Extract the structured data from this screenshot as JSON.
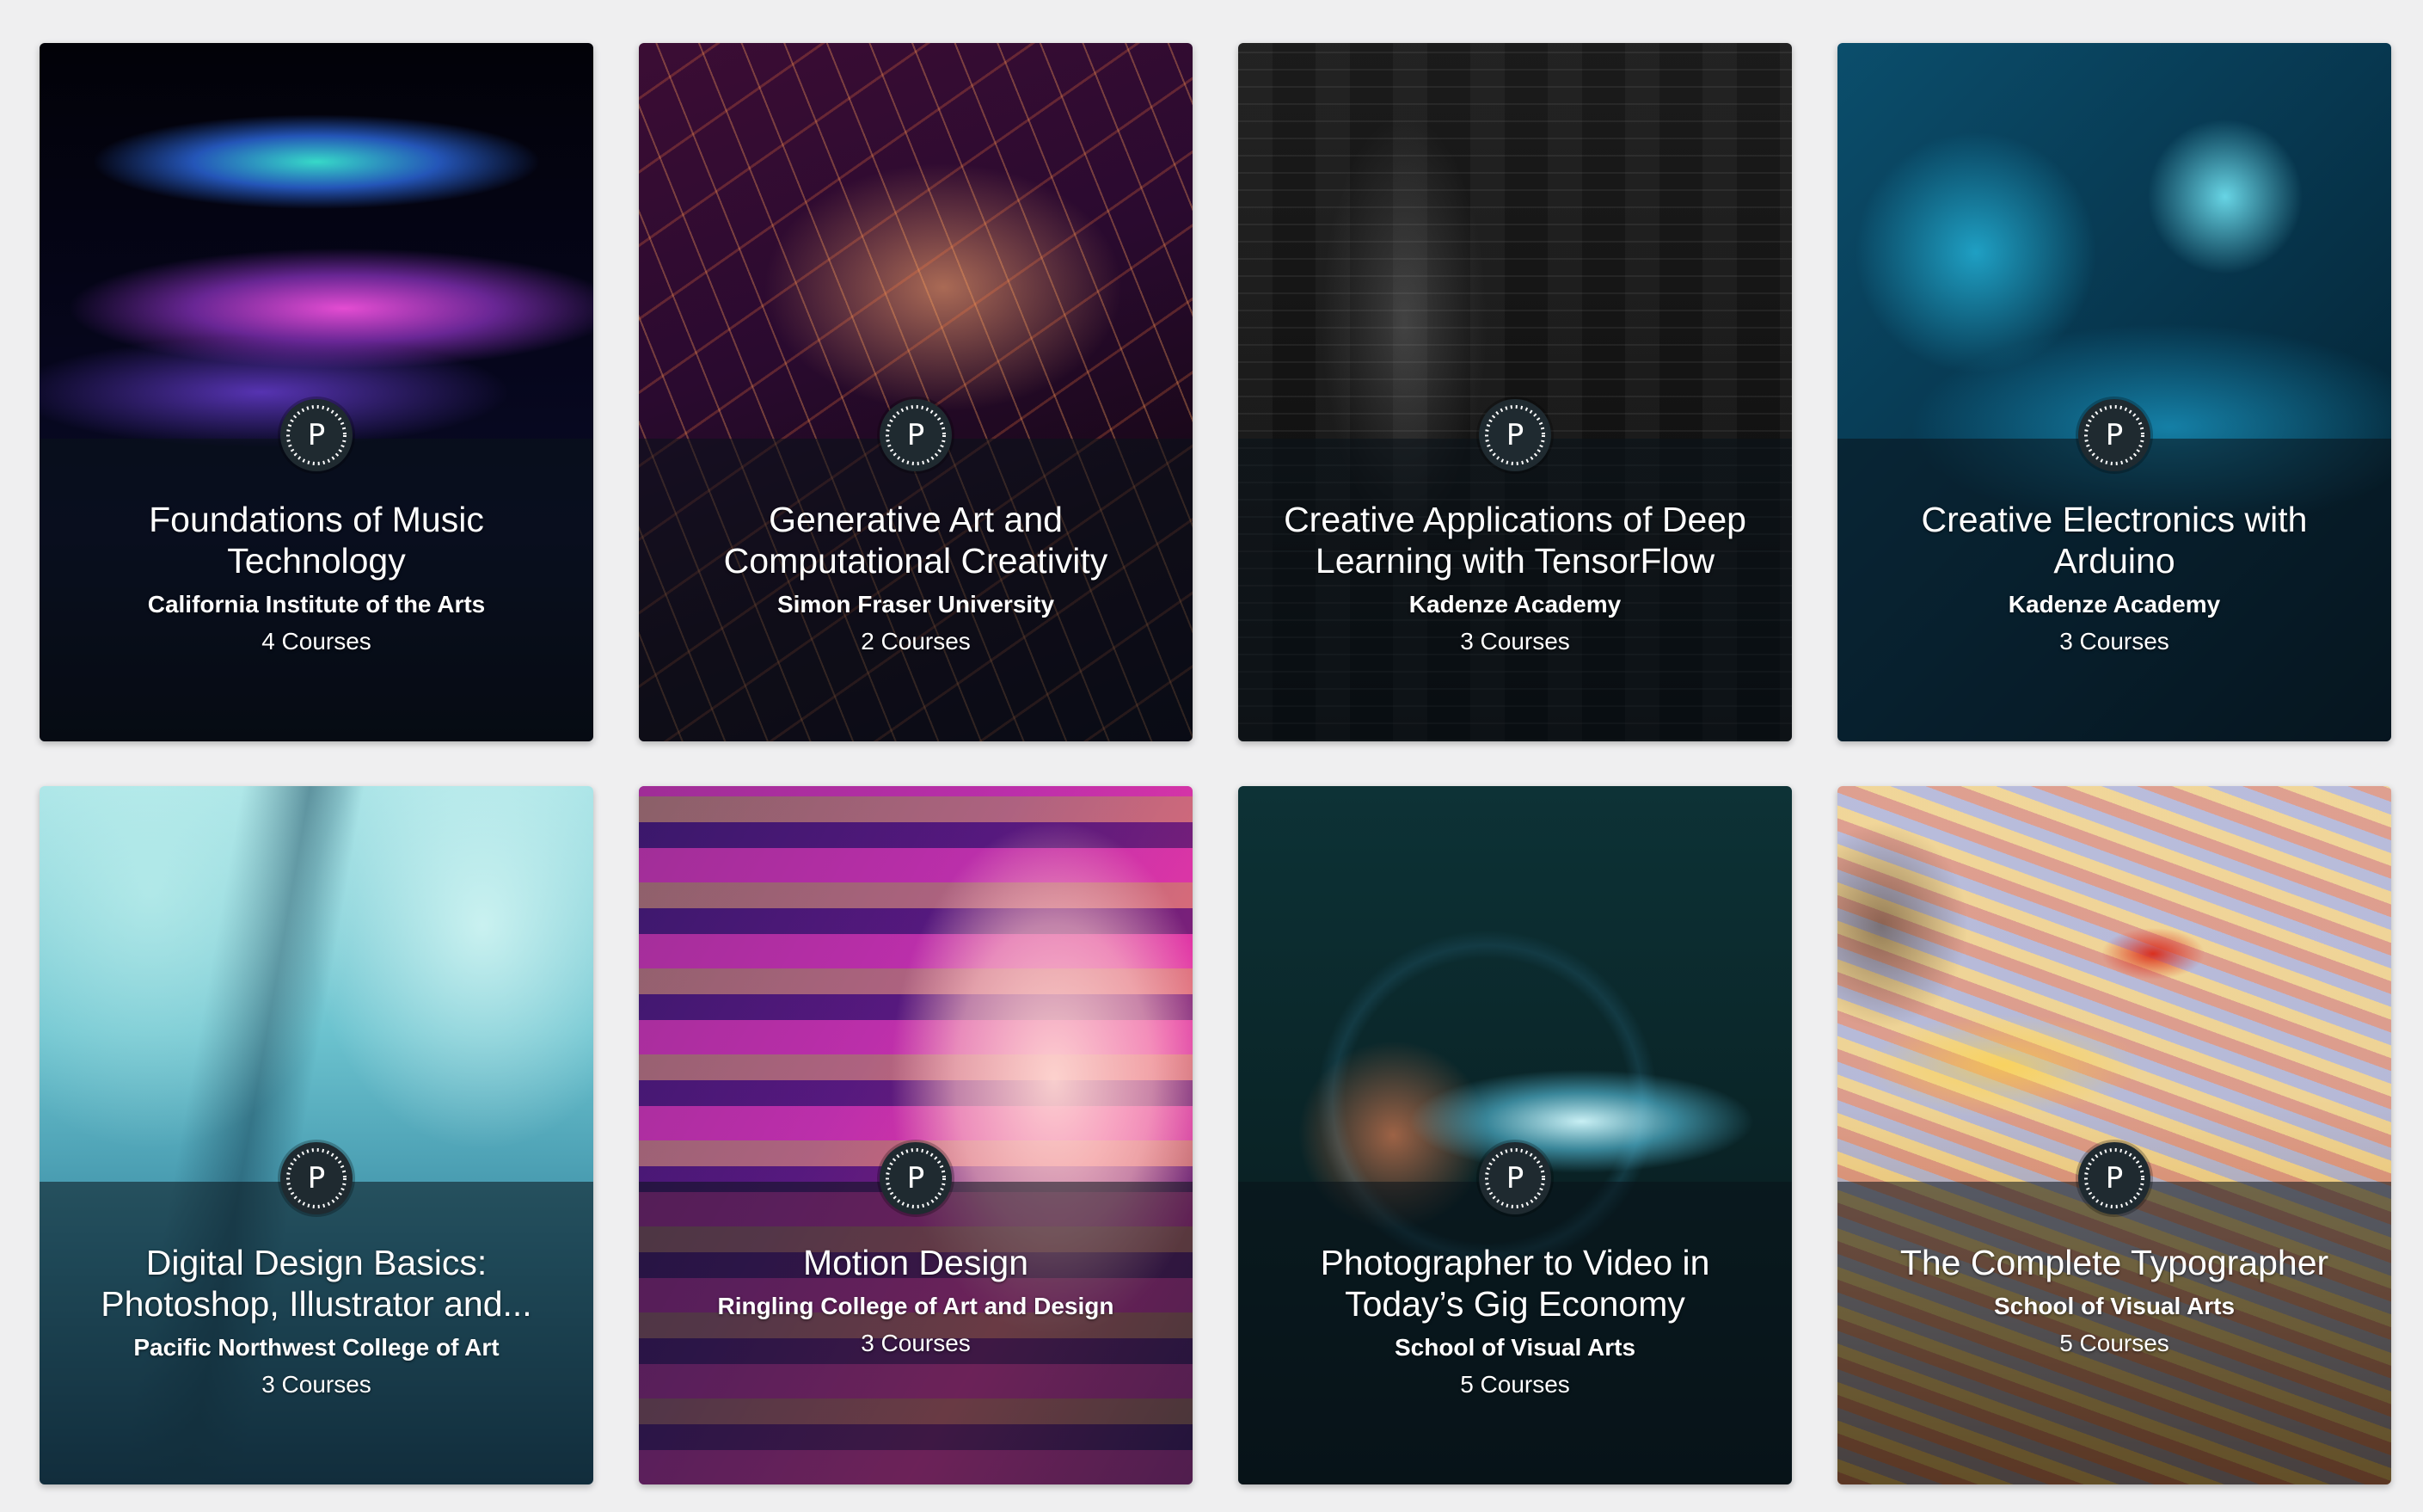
{
  "badge": {
    "letter": "P"
  },
  "cards": [
    {
      "title": "Foundations of Music\nTechnology",
      "organization": "California Institute of the Arts",
      "courses": "4 Courses"
    },
    {
      "title": "Generative Art and\nComputational Creativity",
      "organization": "Simon Fraser University",
      "courses": "2 Courses"
    },
    {
      "title": "Creative Applications of Deep\nLearning with TensorFlow",
      "organization": "Kadenze Academy",
      "courses": "3 Courses"
    },
    {
      "title": "Creative Electronics with\nArduino",
      "organization": "Kadenze Academy",
      "courses": "3 Courses"
    },
    {
      "title": "Digital Design Basics:\nPhotoshop, Illustrator and...",
      "organization": "Pacific Northwest College of Art",
      "courses": "3 Courses"
    },
    {
      "title": "Motion Design",
      "organization": "Ringling College of Art and Design",
      "courses": "3 Courses"
    },
    {
      "title": "Photographer to Video in\nToday’s Gig Economy",
      "organization": "School of Visual Arts",
      "courses": "5 Courses"
    },
    {
      "title": "The Complete Typographer",
      "organization": "School of Visual Arts",
      "courses": "5 Courses"
    }
  ]
}
